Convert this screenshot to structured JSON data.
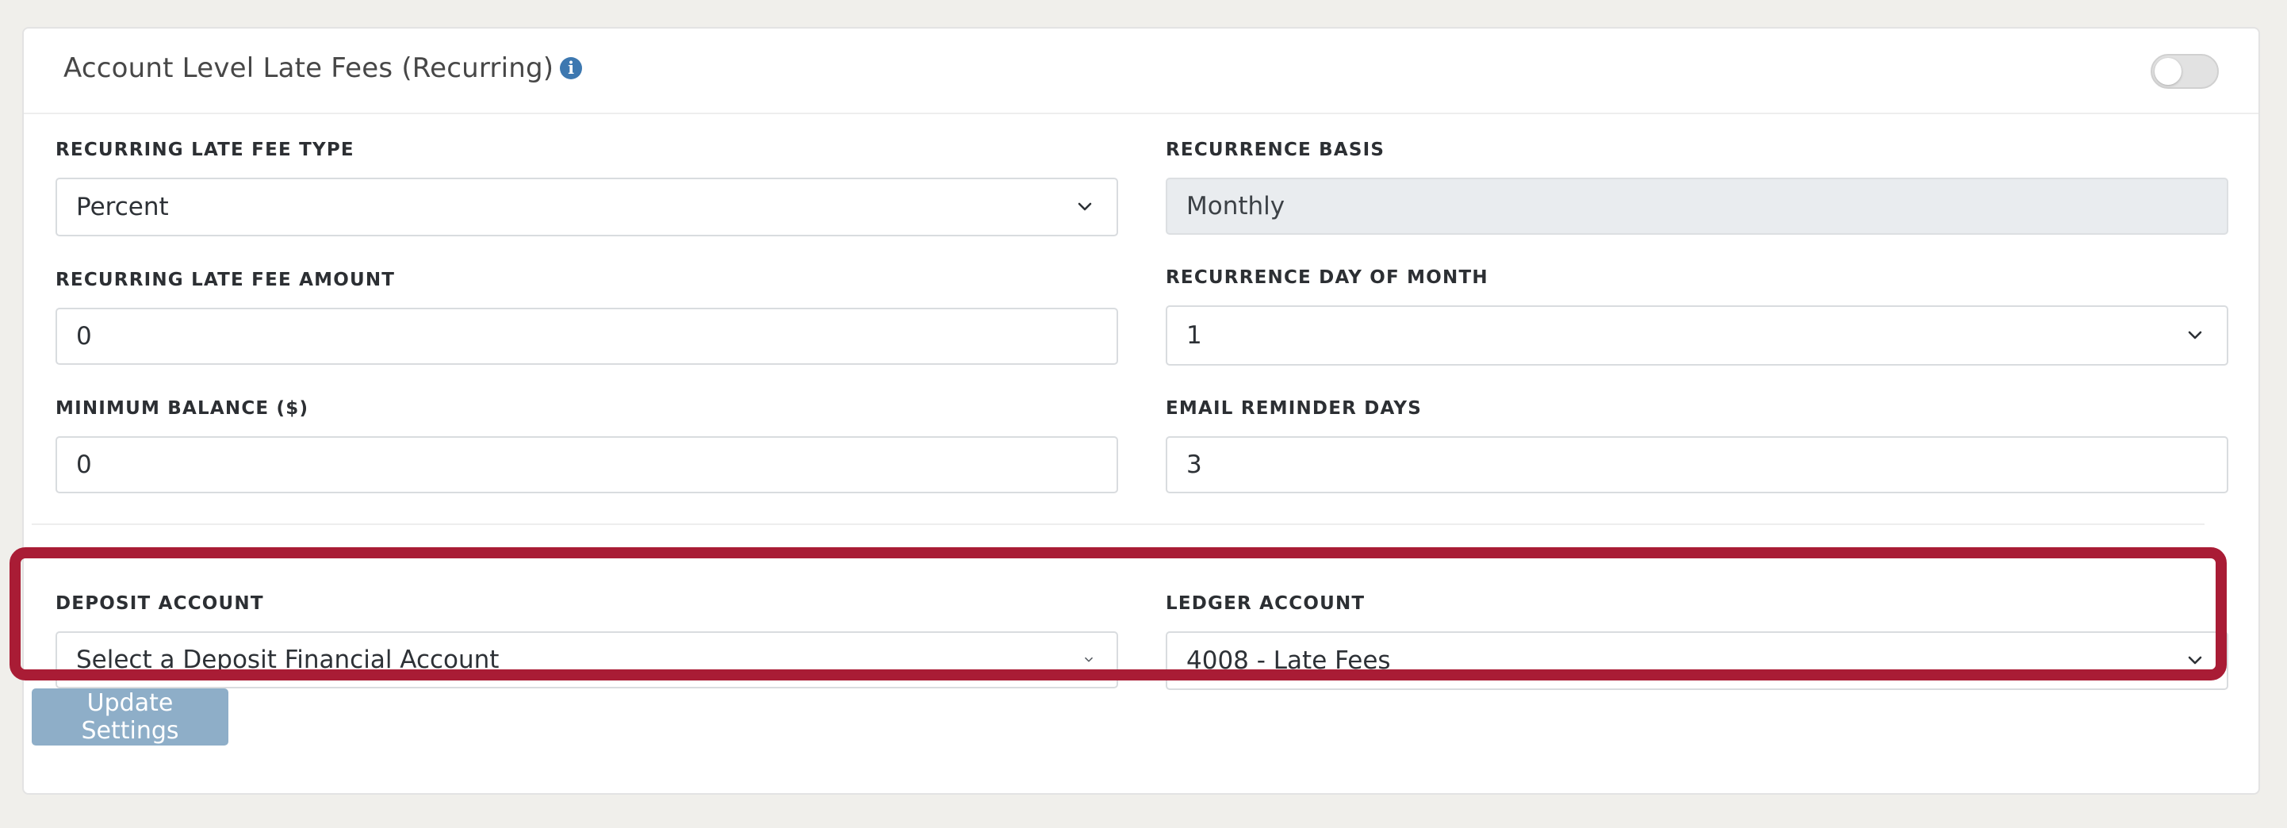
{
  "header": {
    "title": "Account Level Late Fees (Recurring)",
    "info_icon": "info-circle-icon",
    "toggle_on": false
  },
  "fields": {
    "fee_type": {
      "label": "RECURRING LATE FEE TYPE",
      "value": "Percent"
    },
    "recurrence_basis": {
      "label": "RECURRENCE BASIS",
      "value": "Monthly"
    },
    "fee_amount": {
      "label": "RECURRING LATE FEE AMOUNT",
      "value": "0"
    },
    "day_of_month": {
      "label": "RECURRENCE DAY OF MONTH",
      "value": "1"
    },
    "min_balance": {
      "label": "MINIMUM BALANCE ($)",
      "value": "0"
    },
    "reminder_days": {
      "label": "EMAIL REMINDER DAYS",
      "value": "3"
    },
    "deposit_account": {
      "label": "DEPOSIT ACCOUNT",
      "placeholder": "Select a Deposit Financial Account"
    },
    "ledger_account": {
      "label": "LEDGER ACCOUNT",
      "value": "4008 - Late Fees"
    }
  },
  "actions": {
    "update_label": "Update Settings"
  },
  "colors": {
    "highlight": "#a91c35",
    "button": "#8eaec8",
    "info": "#3d78b0",
    "readonly_bg": "#e9ecef"
  }
}
